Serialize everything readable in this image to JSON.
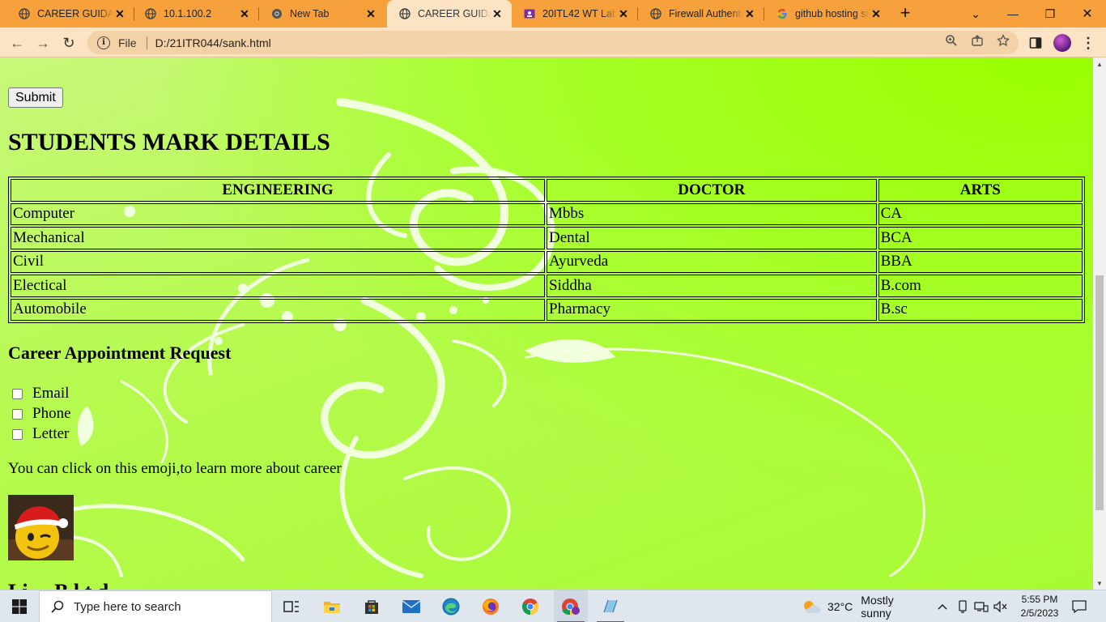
{
  "browser": {
    "tabs": [
      {
        "title": "CAREER GUIDAN",
        "favicon": "globe-icon",
        "active": false
      },
      {
        "title": "10.1.100.2",
        "favicon": "globe-icon",
        "active": false
      },
      {
        "title": "New Tab",
        "favicon": "chrome-icon",
        "active": false
      },
      {
        "title": "CAREER GUIDAN",
        "favicon": "globe-icon",
        "active": true
      },
      {
        "title": "20ITL42 WT Lab",
        "favicon": "classroom-icon",
        "active": false
      },
      {
        "title": "Firewall Authenti",
        "favicon": "globe-icon",
        "active": false
      },
      {
        "title": "github hosting si",
        "favicon": "google-icon",
        "active": false
      }
    ],
    "address": {
      "scheme": "File",
      "url": "D:/21ITR044/sank.html"
    }
  },
  "page": {
    "submit_label": "Submit",
    "heading": "STUDENTS MARK DETAILS",
    "table": {
      "headers": [
        "ENGINEERING",
        "DOCTOR",
        "ARTS"
      ],
      "rows": [
        [
          "Computer",
          "Mbbs",
          "CA"
        ],
        [
          "Mechanical",
          "Dental",
          "BCA"
        ],
        [
          "Civil",
          "Ayurveda",
          "BBA"
        ],
        [
          "Electical",
          "Siddha",
          "B.com"
        ],
        [
          "Automobile",
          "Pharmacy",
          "B.sc"
        ]
      ]
    },
    "appointment_heading": "Career Appointment Request",
    "contact_options": [
      "Email",
      "Phone",
      "Letter"
    ],
    "note": "You can click on this emoji,to learn more about career",
    "partial_heading": "Li  . . B  l  t  d"
  },
  "taskbar": {
    "search_placeholder": "Type here to search",
    "weather": {
      "temp": "32°C",
      "condition": "Mostly sunny"
    },
    "time": "5:55 PM",
    "date": "2/5/2023"
  },
  "colors": {
    "tab_strip": "#f6a13b",
    "toolbar": "#fbe3c3",
    "page_background": "#a8fb33"
  }
}
